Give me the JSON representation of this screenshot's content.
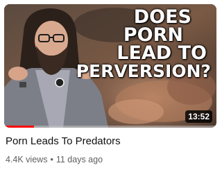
{
  "video": {
    "thumbnail_text": [
      "DOES",
      "PORN",
      "LEAD TO",
      "PERVERSION?"
    ],
    "duration": "13:52",
    "watch_progress_percent": 14,
    "title": "Porn Leads To Predators",
    "views": "4.4K views",
    "separator": "•",
    "age": "11 days ago"
  },
  "colors": {
    "progress": "#ff0000",
    "title": "#0f0f0f",
    "meta": "#606060"
  }
}
